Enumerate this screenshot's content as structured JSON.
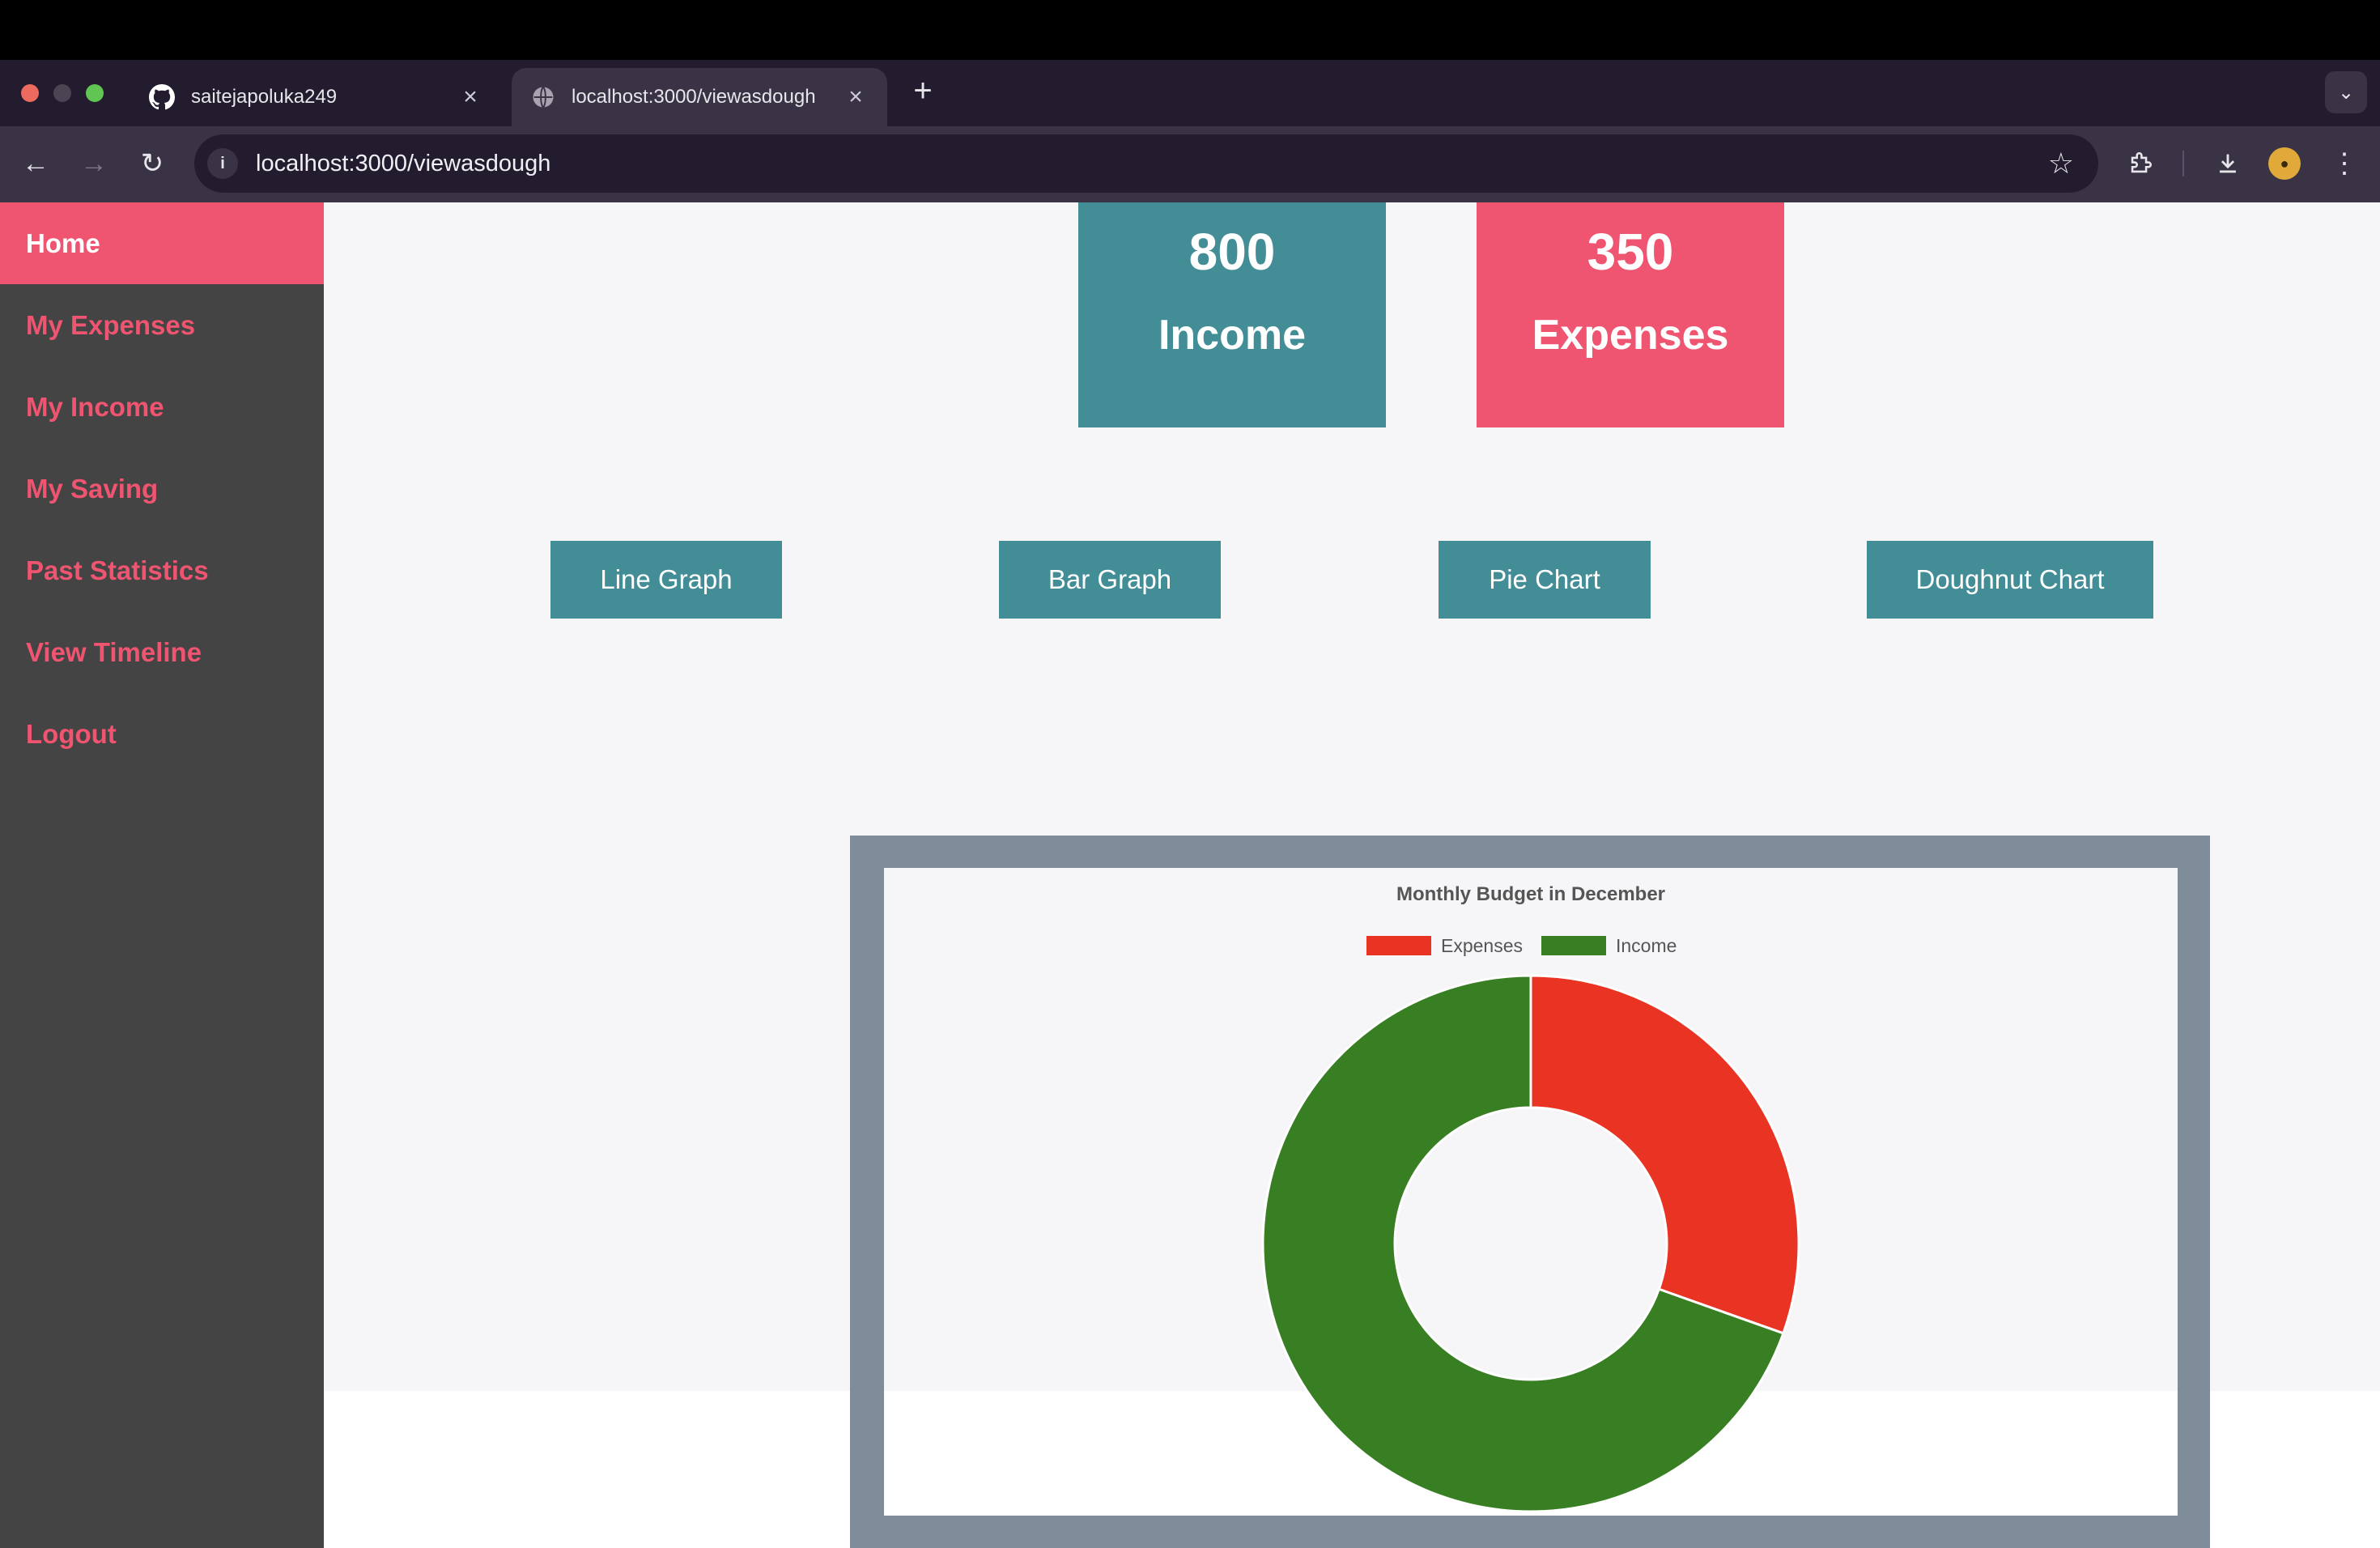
{
  "browser": {
    "tabs": [
      {
        "title": "saitejapoluka249",
        "icon": "github-icon",
        "active": false
      },
      {
        "title": "localhost:3000/viewasdough",
        "icon": "globe-icon",
        "active": true
      }
    ],
    "url": "localhost:3000/viewasdough"
  },
  "sidebar": {
    "items": [
      {
        "label": "Home",
        "active": true
      },
      {
        "label": "My Expenses"
      },
      {
        "label": "My Income"
      },
      {
        "label": "My Saving"
      },
      {
        "label": "Past Statistics"
      },
      {
        "label": "View Timeline"
      },
      {
        "label": "Logout"
      }
    ]
  },
  "stats": {
    "income": {
      "amount": "800",
      "label": "Income"
    },
    "expenses": {
      "amount": "350",
      "label": "Expenses"
    }
  },
  "chart_buttons": [
    "Line Graph",
    "Bar Graph",
    "Pie Chart",
    "Doughnut Chart"
  ],
  "colors": {
    "accent_teal": "#438d96",
    "accent_pink": "#ef5470",
    "sidebar_bg": "#444444",
    "expenses_slice": "#e93323",
    "income_slice": "#387e22"
  },
  "chart_data": {
    "type": "doughnut",
    "title": "Monthly Budget in December",
    "categories": [
      "Expenses",
      "Income"
    ],
    "values": [
      350,
      800
    ],
    "colors": [
      "#e93323",
      "#387e22"
    ],
    "legend": "top"
  }
}
